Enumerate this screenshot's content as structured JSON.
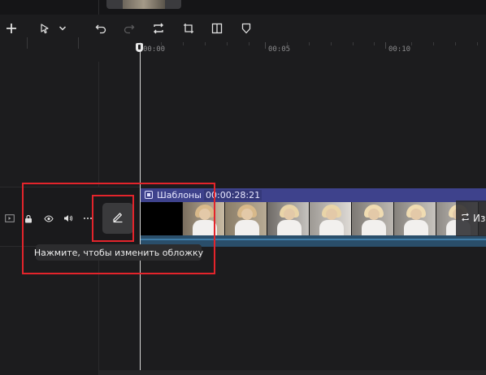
{
  "toolbar": {
    "add": "plus-icon",
    "select": "cursor-icon",
    "select_menu": "chevron-down-icon",
    "undo": "undo-icon",
    "redo": "redo-icon",
    "loop": "loop-icon",
    "crop": "crop-icon",
    "split": "split-icon",
    "marker": "shield-icon"
  },
  "ruler": {
    "labels": [
      "00:00",
      "00:05",
      "00:10"
    ]
  },
  "track": {
    "icons": [
      "video-track-icon",
      "lock-icon",
      "eye-icon",
      "volume-icon",
      "more-icon"
    ],
    "cover_button_icon": "pencil-icon",
    "tooltip": "Нажмите, чтобы изменить обложку"
  },
  "clip": {
    "label": "Шаблоны",
    "duration": "00:00:28:21",
    "replace_label": "Из"
  },
  "colors": {
    "accent": "#3ad0e6",
    "annotation": "#e3242b",
    "clip_header": "#3e428c"
  }
}
